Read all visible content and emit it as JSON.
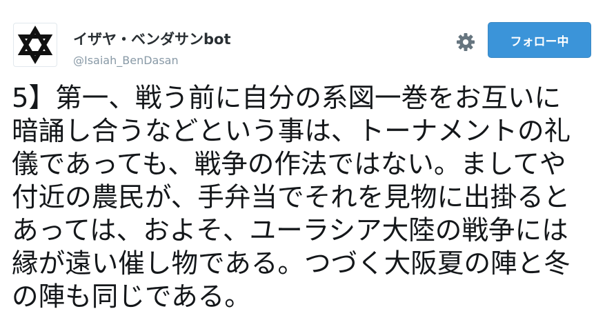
{
  "user": {
    "display_name": "イザヤ・ベンダサンbot",
    "screen_name": "@Isaiah_BenDasan",
    "avatar_icon": "star-of-david-icon"
  },
  "actions": {
    "settings_icon": "gear-icon",
    "follow_label": "フォロー中"
  },
  "tweet": {
    "lines": [
      "5】第一、戦う前に自分の系図一巻をお互いに",
      "暗誦し合うなどという事は、トーナメントの礼",
      "儀であっても、戦争の作法ではない。ましてや",
      "付近の農民が、手弁当でそれを見物に出掛ると",
      "あっては、およそ、ユーラシア大陸の戦争には",
      "縁が遠い催し物である。つづく大阪夏の陣と冬",
      "の陣も同じである。"
    ]
  },
  "colors": {
    "follow_button": "#3b94d9",
    "screen_name": "#8899a6",
    "text": "#14171a"
  }
}
